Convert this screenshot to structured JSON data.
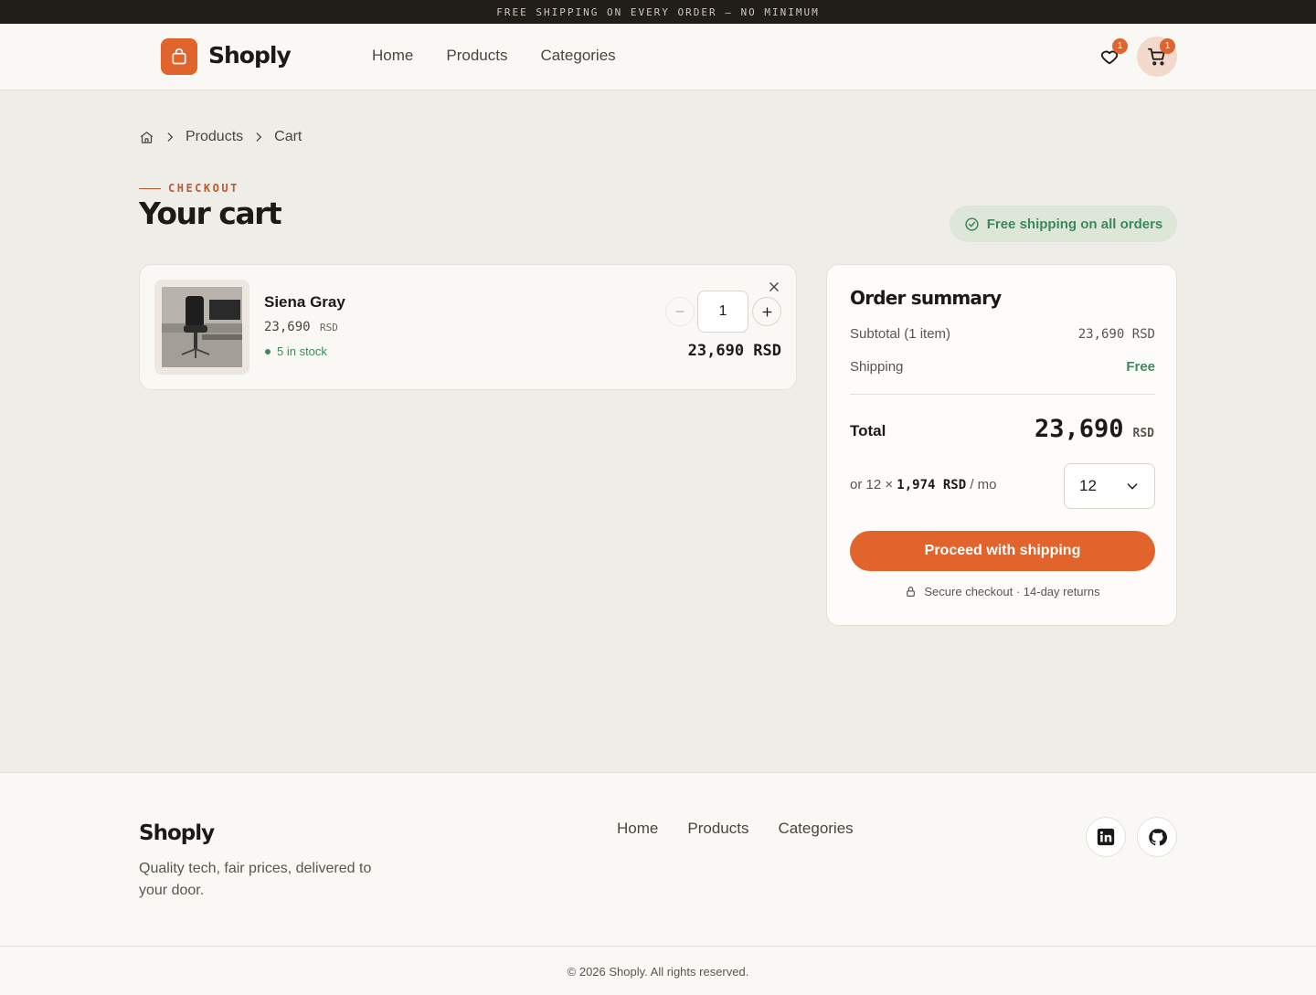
{
  "announcement": "FREE SHIPPING ON EVERY ORDER — NO MINIMUM",
  "header": {
    "brand": "Shoply",
    "nav": [
      "Home",
      "Products",
      "Categories"
    ],
    "wishlist_count": "1",
    "cart_count": "1"
  },
  "breadcrumb": {
    "items": [
      "Products",
      "Cart"
    ]
  },
  "page": {
    "eyebrow": "CHECKOUT",
    "title": "Your cart",
    "shipping_badge": "Free shipping on all orders"
  },
  "cart": {
    "items": [
      {
        "name": "Siena Gray",
        "unit_price": "23,690",
        "currency": "RSD",
        "stock": "5 in stock",
        "quantity": "1",
        "line_total": "23,690 RSD"
      }
    ]
  },
  "summary": {
    "title": "Order summary",
    "subtotal_label": "Subtotal (1 item)",
    "subtotal_value": "23,690 RSD",
    "shipping_label": "Shipping",
    "shipping_value": "Free",
    "total_label": "Total",
    "total_value": "23,690",
    "total_currency": "RSD",
    "installment_prefix": "or 12 ×",
    "installment_amount": "1,974 RSD",
    "installment_suffix": "/ mo",
    "months_selected": "12",
    "cta": "Proceed with shipping",
    "secure_note": "Secure checkout · 14-day returns"
  },
  "footer": {
    "brand": "Shoply",
    "tagline": "Quality tech, fair prices, delivered to your door.",
    "nav": [
      "Home",
      "Products",
      "Categories"
    ],
    "copyright": "© 2026 Shoply. All rights reserved."
  },
  "colors": {
    "accent": "#e0642c",
    "success": "#3b8a5a",
    "background": "#efede7",
    "dark": "#211d18"
  }
}
